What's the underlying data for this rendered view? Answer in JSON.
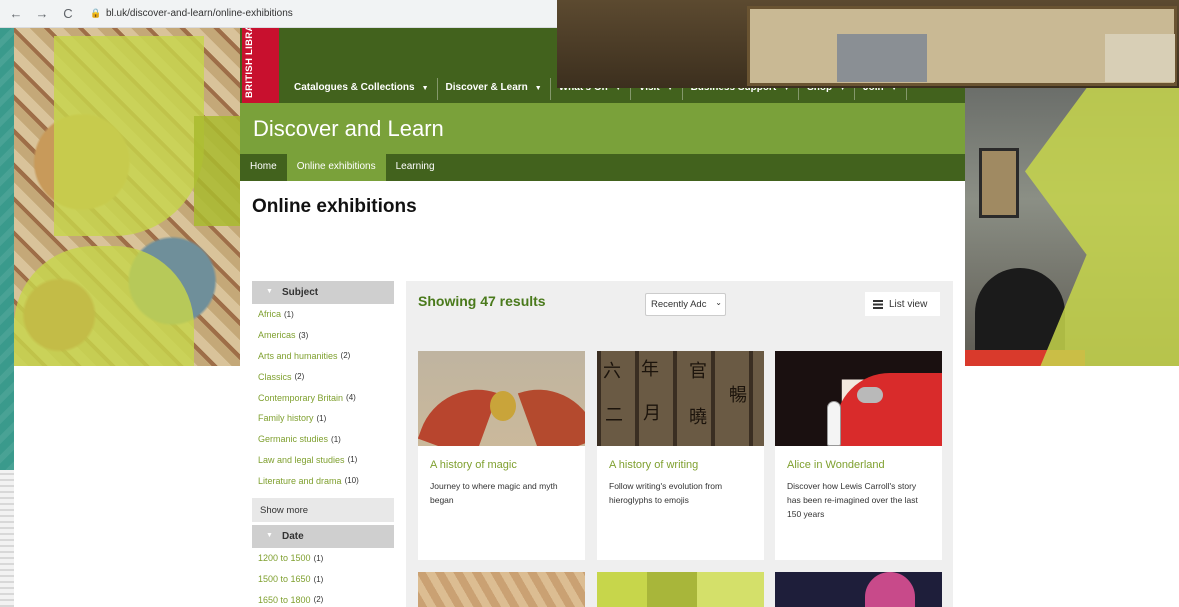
{
  "browser": {
    "back": "←",
    "forward": "→",
    "reload": "C",
    "url": "bl.uk/discover-and-learn/online-exhibitions"
  },
  "logo": {
    "text": "BRITISH LIBRARY"
  },
  "main_nav": [
    {
      "label": "Catalogues & Collections"
    },
    {
      "label": "Discover & Learn"
    },
    {
      "label": "What's On"
    },
    {
      "label": "Visit"
    },
    {
      "label": "Business Support"
    },
    {
      "label": "Shop"
    },
    {
      "label": "Join"
    }
  ],
  "section": {
    "title": "Discover and Learn"
  },
  "sub_nav": [
    {
      "label": "Home"
    },
    {
      "label": "Online exhibitions"
    },
    {
      "label": "Learning"
    }
  ],
  "page": {
    "title": "Online exhibitions"
  },
  "facets": {
    "subject": {
      "heading": "Subject",
      "items": [
        {
          "label": "Africa",
          "count": "(1)"
        },
        {
          "label": "Americas",
          "count": "(3)"
        },
        {
          "label": "Arts and humanities",
          "count": "(2)"
        },
        {
          "label": "Classics",
          "count": "(2)"
        },
        {
          "label": "Contemporary Britain",
          "count": "(4)"
        },
        {
          "label": "Family history",
          "count": "(1)"
        },
        {
          "label": "Germanic studies",
          "count": "(1)"
        },
        {
          "label": "Law and legal studies",
          "count": "(1)"
        },
        {
          "label": "Literature and drama",
          "count": "(10)"
        }
      ],
      "show_more": "Show more"
    },
    "date": {
      "heading": "Date",
      "items": [
        {
          "label": "1200 to 1500",
          "count": "(1)"
        },
        {
          "label": "1500 to 1650",
          "count": "(1)"
        },
        {
          "label": "1650 to 1800",
          "count": "(2)"
        }
      ]
    }
  },
  "results": {
    "count_text": "Showing 47 results",
    "sort_value": "Recently Adc",
    "list_view_label": "List view"
  },
  "cards": [
    {
      "title": "A history of magic",
      "desc": "Journey to where magic and myth began"
    },
    {
      "title": "A history of writing",
      "desc": "Follow writing's evolution from hieroglyphs to emojis"
    },
    {
      "title": "Alice in Wonderland",
      "desc": "Discover how Lewis Carroll's story has been re-imagined over the last 150 years"
    }
  ],
  "writing_glyphs": [
    "年",
    "六",
    "二",
    "月",
    "官",
    "曉",
    "暢"
  ],
  "colors": {
    "header_green": "#42621d",
    "banner_green": "#7aa13a",
    "link_green": "#7fa02f",
    "logo_red": "#c8102e",
    "accent_lime": "#c7d64b"
  }
}
